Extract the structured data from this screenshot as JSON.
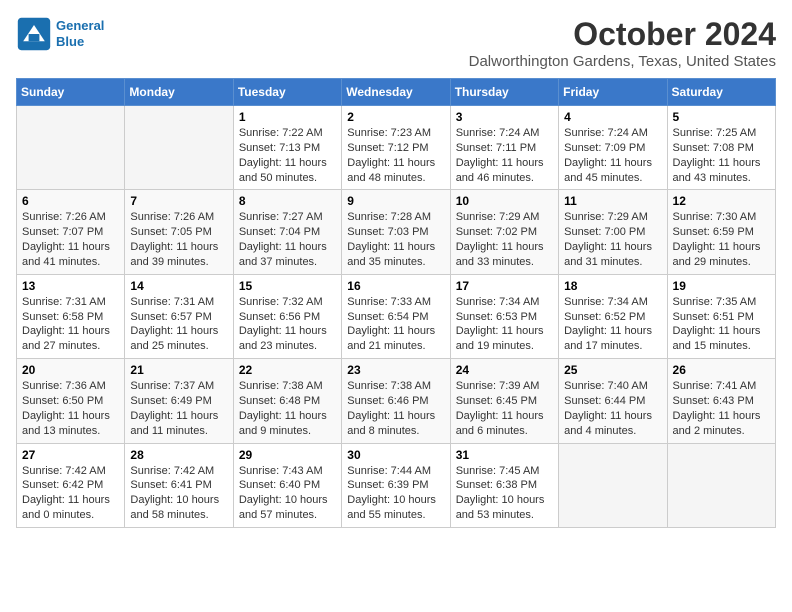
{
  "header": {
    "logo_line1": "General",
    "logo_line2": "Blue",
    "month_title": "October 2024",
    "location": "Dalworthington Gardens, Texas, United States"
  },
  "weekdays": [
    "Sunday",
    "Monday",
    "Tuesday",
    "Wednesday",
    "Thursday",
    "Friday",
    "Saturday"
  ],
  "weeks": [
    [
      {
        "day": "",
        "sunrise": "",
        "sunset": "",
        "daylight": ""
      },
      {
        "day": "",
        "sunrise": "",
        "sunset": "",
        "daylight": ""
      },
      {
        "day": "1",
        "sunrise": "Sunrise: 7:22 AM",
        "sunset": "Sunset: 7:13 PM",
        "daylight": "Daylight: 11 hours and 50 minutes."
      },
      {
        "day": "2",
        "sunrise": "Sunrise: 7:23 AM",
        "sunset": "Sunset: 7:12 PM",
        "daylight": "Daylight: 11 hours and 48 minutes."
      },
      {
        "day": "3",
        "sunrise": "Sunrise: 7:24 AM",
        "sunset": "Sunset: 7:11 PM",
        "daylight": "Daylight: 11 hours and 46 minutes."
      },
      {
        "day": "4",
        "sunrise": "Sunrise: 7:24 AM",
        "sunset": "Sunset: 7:09 PM",
        "daylight": "Daylight: 11 hours and 45 minutes."
      },
      {
        "day": "5",
        "sunrise": "Sunrise: 7:25 AM",
        "sunset": "Sunset: 7:08 PM",
        "daylight": "Daylight: 11 hours and 43 minutes."
      }
    ],
    [
      {
        "day": "6",
        "sunrise": "Sunrise: 7:26 AM",
        "sunset": "Sunset: 7:07 PM",
        "daylight": "Daylight: 11 hours and 41 minutes."
      },
      {
        "day": "7",
        "sunrise": "Sunrise: 7:26 AM",
        "sunset": "Sunset: 7:05 PM",
        "daylight": "Daylight: 11 hours and 39 minutes."
      },
      {
        "day": "8",
        "sunrise": "Sunrise: 7:27 AM",
        "sunset": "Sunset: 7:04 PM",
        "daylight": "Daylight: 11 hours and 37 minutes."
      },
      {
        "day": "9",
        "sunrise": "Sunrise: 7:28 AM",
        "sunset": "Sunset: 7:03 PM",
        "daylight": "Daylight: 11 hours and 35 minutes."
      },
      {
        "day": "10",
        "sunrise": "Sunrise: 7:29 AM",
        "sunset": "Sunset: 7:02 PM",
        "daylight": "Daylight: 11 hours and 33 minutes."
      },
      {
        "day": "11",
        "sunrise": "Sunrise: 7:29 AM",
        "sunset": "Sunset: 7:00 PM",
        "daylight": "Daylight: 11 hours and 31 minutes."
      },
      {
        "day": "12",
        "sunrise": "Sunrise: 7:30 AM",
        "sunset": "Sunset: 6:59 PM",
        "daylight": "Daylight: 11 hours and 29 minutes."
      }
    ],
    [
      {
        "day": "13",
        "sunrise": "Sunrise: 7:31 AM",
        "sunset": "Sunset: 6:58 PM",
        "daylight": "Daylight: 11 hours and 27 minutes."
      },
      {
        "day": "14",
        "sunrise": "Sunrise: 7:31 AM",
        "sunset": "Sunset: 6:57 PM",
        "daylight": "Daylight: 11 hours and 25 minutes."
      },
      {
        "day": "15",
        "sunrise": "Sunrise: 7:32 AM",
        "sunset": "Sunset: 6:56 PM",
        "daylight": "Daylight: 11 hours and 23 minutes."
      },
      {
        "day": "16",
        "sunrise": "Sunrise: 7:33 AM",
        "sunset": "Sunset: 6:54 PM",
        "daylight": "Daylight: 11 hours and 21 minutes."
      },
      {
        "day": "17",
        "sunrise": "Sunrise: 7:34 AM",
        "sunset": "Sunset: 6:53 PM",
        "daylight": "Daylight: 11 hours and 19 minutes."
      },
      {
        "day": "18",
        "sunrise": "Sunrise: 7:34 AM",
        "sunset": "Sunset: 6:52 PM",
        "daylight": "Daylight: 11 hours and 17 minutes."
      },
      {
        "day": "19",
        "sunrise": "Sunrise: 7:35 AM",
        "sunset": "Sunset: 6:51 PM",
        "daylight": "Daylight: 11 hours and 15 minutes."
      }
    ],
    [
      {
        "day": "20",
        "sunrise": "Sunrise: 7:36 AM",
        "sunset": "Sunset: 6:50 PM",
        "daylight": "Daylight: 11 hours and 13 minutes."
      },
      {
        "day": "21",
        "sunrise": "Sunrise: 7:37 AM",
        "sunset": "Sunset: 6:49 PM",
        "daylight": "Daylight: 11 hours and 11 minutes."
      },
      {
        "day": "22",
        "sunrise": "Sunrise: 7:38 AM",
        "sunset": "Sunset: 6:48 PM",
        "daylight": "Daylight: 11 hours and 9 minutes."
      },
      {
        "day": "23",
        "sunrise": "Sunrise: 7:38 AM",
        "sunset": "Sunset: 6:46 PM",
        "daylight": "Daylight: 11 hours and 8 minutes."
      },
      {
        "day": "24",
        "sunrise": "Sunrise: 7:39 AM",
        "sunset": "Sunset: 6:45 PM",
        "daylight": "Daylight: 11 hours and 6 minutes."
      },
      {
        "day": "25",
        "sunrise": "Sunrise: 7:40 AM",
        "sunset": "Sunset: 6:44 PM",
        "daylight": "Daylight: 11 hours and 4 minutes."
      },
      {
        "day": "26",
        "sunrise": "Sunrise: 7:41 AM",
        "sunset": "Sunset: 6:43 PM",
        "daylight": "Daylight: 11 hours and 2 minutes."
      }
    ],
    [
      {
        "day": "27",
        "sunrise": "Sunrise: 7:42 AM",
        "sunset": "Sunset: 6:42 PM",
        "daylight": "Daylight: 11 hours and 0 minutes."
      },
      {
        "day": "28",
        "sunrise": "Sunrise: 7:42 AM",
        "sunset": "Sunset: 6:41 PM",
        "daylight": "Daylight: 10 hours and 58 minutes."
      },
      {
        "day": "29",
        "sunrise": "Sunrise: 7:43 AM",
        "sunset": "Sunset: 6:40 PM",
        "daylight": "Daylight: 10 hours and 57 minutes."
      },
      {
        "day": "30",
        "sunrise": "Sunrise: 7:44 AM",
        "sunset": "Sunset: 6:39 PM",
        "daylight": "Daylight: 10 hours and 55 minutes."
      },
      {
        "day": "31",
        "sunrise": "Sunrise: 7:45 AM",
        "sunset": "Sunset: 6:38 PM",
        "daylight": "Daylight: 10 hours and 53 minutes."
      },
      {
        "day": "",
        "sunrise": "",
        "sunset": "",
        "daylight": ""
      },
      {
        "day": "",
        "sunrise": "",
        "sunset": "",
        "daylight": ""
      }
    ]
  ]
}
